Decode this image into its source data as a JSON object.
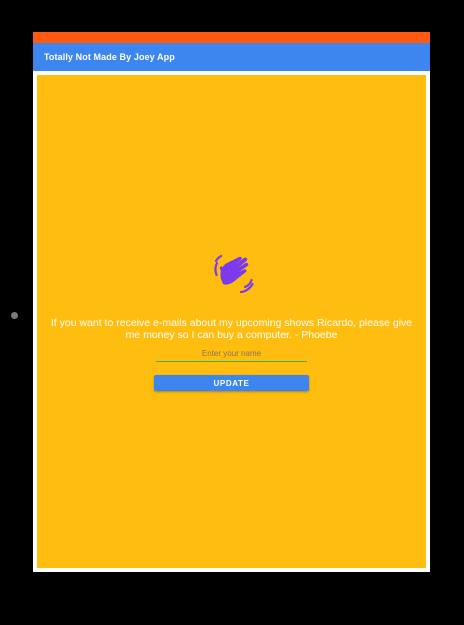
{
  "app": {
    "title": "Totally Not Made By Joey App"
  },
  "main": {
    "icon": "waving-hand-icon",
    "message": "If you want to receive e-mails about my upcoming shows Ricardo, please give me money so I can buy a computer. - Phoebe",
    "name_input": {
      "placeholder": "Enter your name",
      "value": ""
    },
    "update_label": "UPDATE"
  },
  "colors": {
    "status_bar": "#ff5a10",
    "app_bar": "#3d86f0",
    "content_background": "#ffbd10",
    "icon": "#7c3aed",
    "button": "#3d86f0",
    "input_underline": "#39b54a"
  }
}
